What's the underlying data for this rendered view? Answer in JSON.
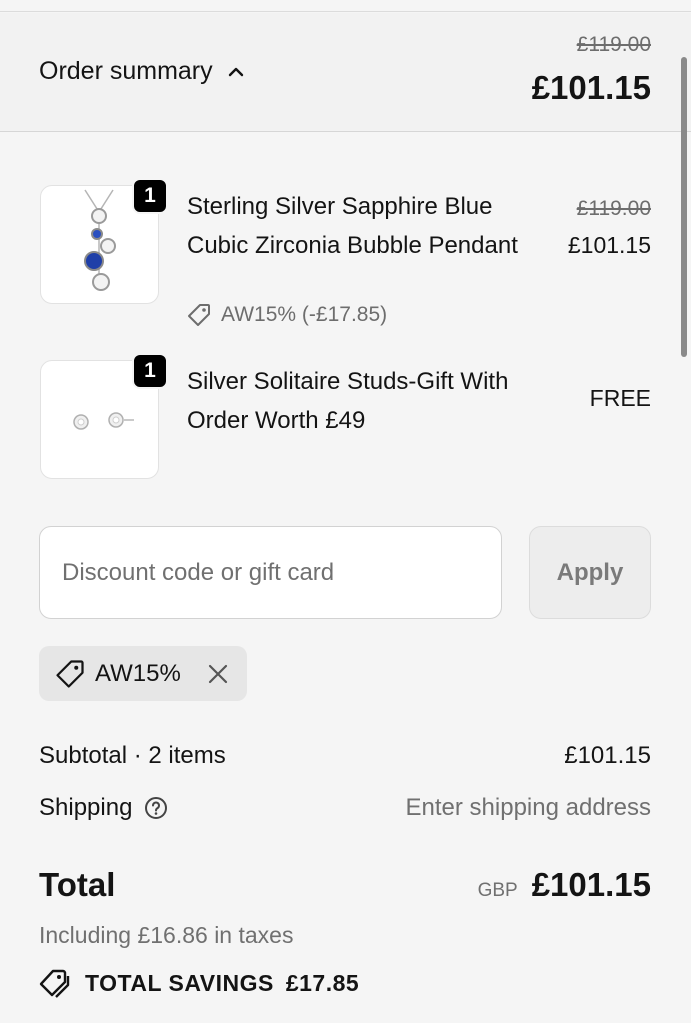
{
  "header": {
    "toggle_label": "Order summary",
    "original_total": "£119.00",
    "total": "£101.15"
  },
  "items": [
    {
      "name": "Sterling Silver Sapphire Blue Cubic Zirconia Bubble Pendant",
      "quantity": "1",
      "original_price": "£119.00",
      "price": "£101.15",
      "discount": "AW15% (-£17.85)"
    },
    {
      "name": "Silver Solitaire Studs-Gift With Order Worth £49",
      "quantity": "1",
      "price": "FREE"
    }
  ],
  "discount": {
    "placeholder": "Discount code or gift card",
    "apply_label": "Apply",
    "applied_code": "AW15%"
  },
  "totals": {
    "subtotal_label": "Subtotal · 2 items",
    "subtotal_value": "£101.15",
    "shipping_label": "Shipping",
    "shipping_value": "Enter shipping address",
    "total_label": "Total",
    "currency": "GBP",
    "total_value": "£101.15",
    "tax_note": "Including £16.86 in taxes",
    "savings_label": "TOTAL SAVINGS",
    "savings_value": "£17.85"
  },
  "colors": {
    "background": "#f5f5f5",
    "text": "#141414",
    "muted": "#707070",
    "sapphire": "#1f3fa8"
  }
}
